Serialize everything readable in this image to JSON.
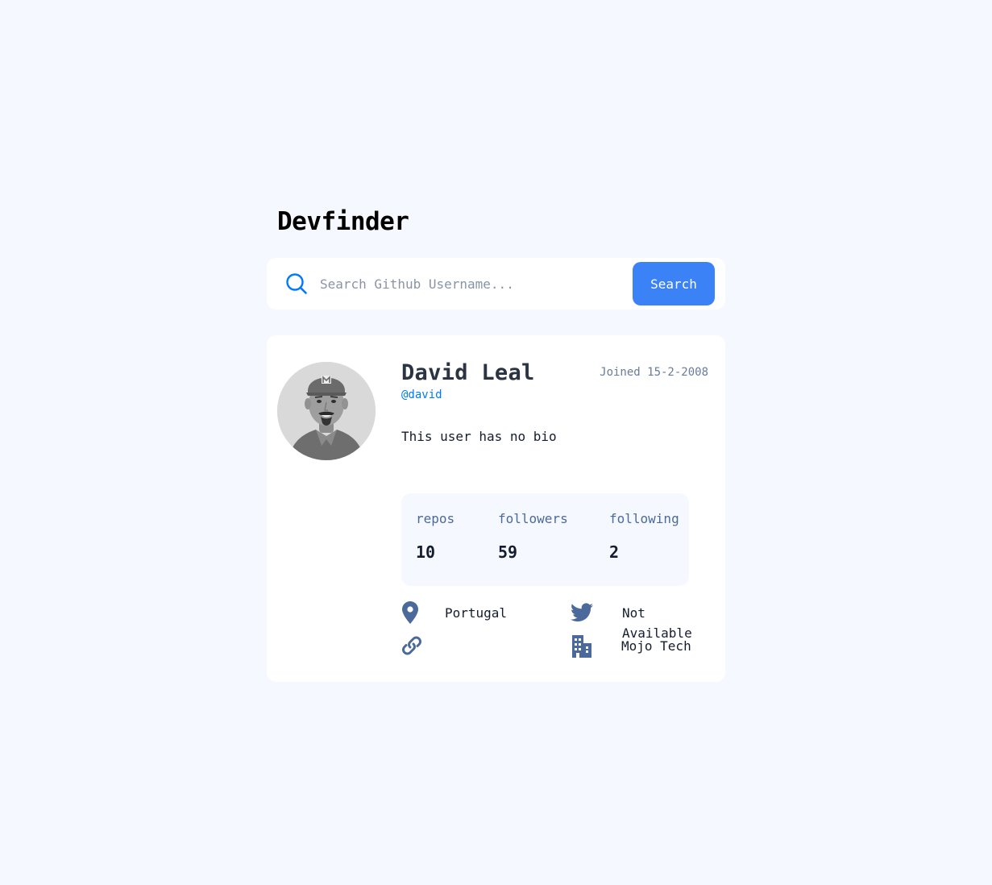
{
  "app": {
    "title": "Devfinder"
  },
  "search": {
    "placeholder": "Search Github Username...",
    "value": "",
    "button_label": "Search"
  },
  "profile": {
    "name": "David Leal",
    "handle": "@david",
    "joined": "Joined 15-2-2008",
    "bio": "This user has no bio",
    "avatar_alt": "David Leal avatar"
  },
  "stats": [
    {
      "label": "repos",
      "value": "10"
    },
    {
      "label": "followers",
      "value": "59"
    },
    {
      "label": "following",
      "value": "2"
    }
  ],
  "links": {
    "location": "Portugal",
    "twitter_line1": "Not",
    "twitter_line2": "Available",
    "website": "",
    "company": "Mojo Tech"
  },
  "icons": {
    "search": "search-icon",
    "location": "map-pin-icon",
    "twitter": "twitter-icon",
    "website": "link-icon",
    "company": "building-icon"
  },
  "colors": {
    "background": "#F5F8FE",
    "card": "#FFFFFF",
    "accent": "#3B82F6",
    "link": "#0079FF",
    "muted": "#697C9A",
    "icon": "#4B6A9B"
  }
}
